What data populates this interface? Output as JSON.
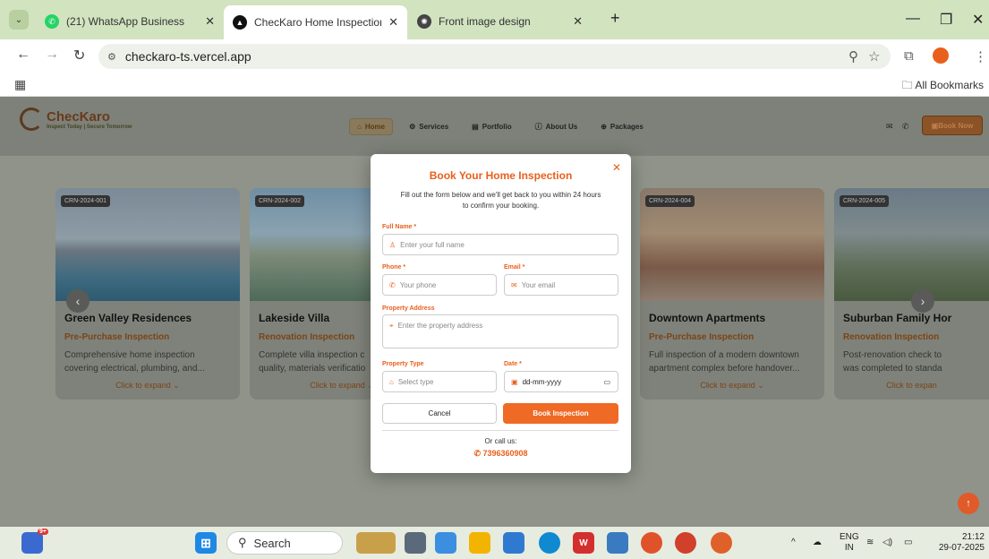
{
  "browser": {
    "tabs": [
      {
        "label": "(21) WhatsApp Business",
        "icon": "whatsapp-icon",
        "color": "#25d366"
      },
      {
        "label": "ChecKaro Home Inspection - In",
        "icon": "vercel-icon",
        "color": "#000000"
      },
      {
        "label": "Front image design",
        "icon": "openai-icon",
        "color": "#333333"
      }
    ],
    "new_tab": "+",
    "url": "checkaro-ts.vercel.app",
    "all_bookmarks": "All Bookmarks"
  },
  "site": {
    "brand": "ChecKaro",
    "tagline": "Inspect Today | Secure Tomorrow",
    "nav": [
      "Home",
      "Services",
      "Portfolio",
      "About Us",
      "Packages"
    ],
    "book_now": "Book Now",
    "accent": "#ef6a24"
  },
  "cards": [
    {
      "code": "CRN-2024-001",
      "title": "Green Valley Residences",
      "type": "Pre-Purchase Inspection",
      "desc1": "Comprehensive home inspection",
      "desc2": "covering electrical, plumbing, and...",
      "expand": "Click to expand ⌄"
    },
    {
      "code": "CRN-2024-002",
      "title": "Lakeside Villa",
      "type": "Renovation Inspection",
      "desc1": "Complete villa inspection c",
      "desc2": "quality, materials verificatio",
      "expand": "Click to expand ⌄"
    },
    {
      "code": "CRN-2024-004",
      "title": "Downtown Apartments",
      "type": "Pre-Purchase Inspection",
      "desc1": "Full inspection of a modern downtown",
      "desc2": "apartment complex before handover...",
      "expand": "Click to expand ⌄"
    },
    {
      "code": "CRN-2024-005",
      "title": "Suburban Family Hor",
      "type": "Renovation Inspection",
      "desc1": "Post-renovation check to",
      "desc2": "was completed to standa",
      "expand": "Click to expan"
    }
  ],
  "modal": {
    "title": "Book Your Home Inspection",
    "subtitle1": "Fill out the form below and we'll get back to you within 24 hours",
    "subtitle2": "to confirm your booking.",
    "full_name_label": "Full Name *",
    "full_name_placeholder": "Enter your full name",
    "phone_label": "Phone *",
    "phone_placeholder": "Your phone",
    "email_label": "Email *",
    "email_placeholder": "Your email",
    "address_label": "Property Address",
    "address_placeholder": "Enter the property address",
    "type_label": "Property Type",
    "type_placeholder": "Select type",
    "date_label": "Date *",
    "date_placeholder": "dd-mm-yyyy",
    "cancel": "Cancel",
    "submit": "Book Inspection",
    "or_call": "Or call us:",
    "phone_number": "7396360908"
  },
  "taskbar": {
    "search": "Search",
    "notification_badge": "9+",
    "lang1": "ENG",
    "lang2": "IN",
    "time": "21:12",
    "date": "29-07-2025"
  }
}
